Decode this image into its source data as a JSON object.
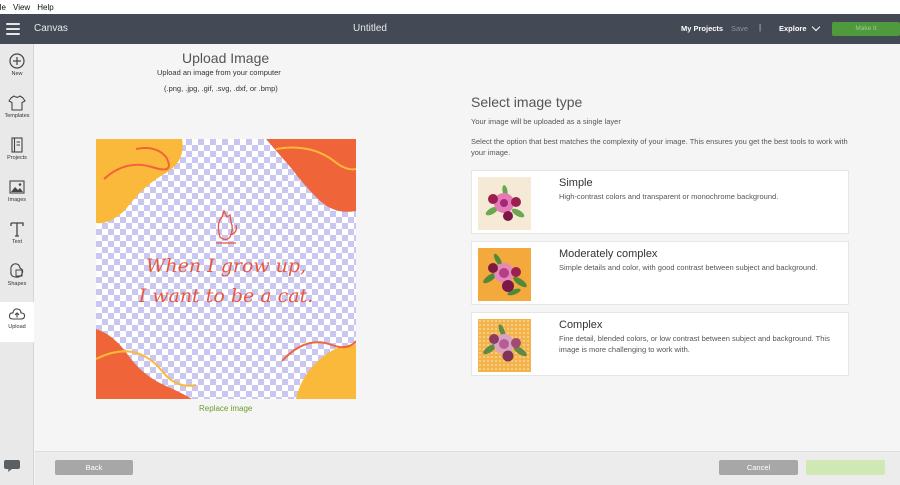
{
  "menubar": {
    "items": [
      "ile",
      "View",
      "Help"
    ]
  },
  "header": {
    "app_title": "Canvas",
    "doc_title": "Untitled",
    "my_projects": "My Projects",
    "save": "Save",
    "divider": "|",
    "explore": "Explore",
    "make_it": "Make It",
    "icons": [
      "hamburger-icon",
      "chevron-down-icon"
    ]
  },
  "toolbar": {
    "items": [
      {
        "label": "New",
        "icon": "plus-circle-icon"
      },
      {
        "label": "Templates",
        "icon": "shirt-icon"
      },
      {
        "label": "Projects",
        "icon": "projects-icon"
      },
      {
        "label": "Images",
        "icon": "image-icon"
      },
      {
        "label": "Text",
        "icon": "text-icon"
      },
      {
        "label": "Shapes",
        "icon": "shapes-icon"
      },
      {
        "label": "Upload",
        "icon": "cloud-upload-icon"
      }
    ],
    "active": "Upload",
    "chat_icon": "chat-icon"
  },
  "upload": {
    "title": "Upload Image",
    "subtitle": "Upload an image from your computer",
    "formats": "(.png, .jpg, .gif, .svg, .dxf, or .bmp)",
    "quote_line1": "When I grow up,",
    "quote_line2": "I want to be a cat.",
    "replace_link": "Replace image"
  },
  "select": {
    "title": "Select image type",
    "note": "Your image will be uploaded as a single layer",
    "description": "Select the option that best matches the complexity of your image. This ensures you get the best tools to work with your image.",
    "options": [
      {
        "title": "Simple",
        "desc": "High-contrast colors and transparent or monochrome background."
      },
      {
        "title": "Moderately complex",
        "desc": "Simple details and color, with good contrast between subject and background."
      },
      {
        "title": "Complex",
        "desc": "Fine detail, blended colors, or low contrast between subject and background. This image is more challenging to work with."
      }
    ]
  },
  "footer": {
    "back": "Back",
    "cancel": "Cancel",
    "continue": "Continue"
  },
  "colors": {
    "header_bg": "#434a55",
    "accent_green": "#4e9a3c",
    "link_green": "#6c9d2b",
    "quote_red": "#e8573e",
    "art_orange": "#f0643a",
    "art_yellow": "#fbb93b"
  }
}
